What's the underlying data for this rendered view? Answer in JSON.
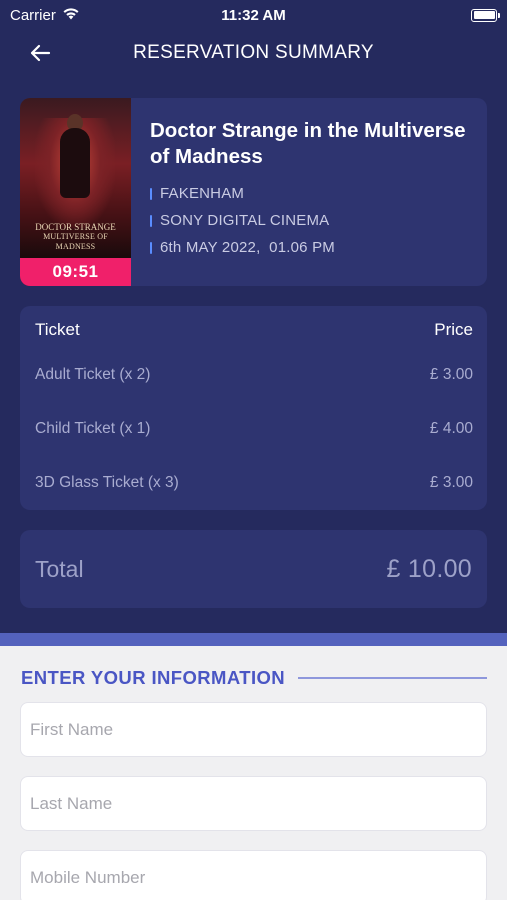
{
  "status_bar": {
    "carrier": "Carrier",
    "time": "11:32 AM",
    "icons": [
      "wifi-icon",
      "battery-icon"
    ]
  },
  "nav": {
    "back_icon": "arrow-left-icon",
    "title": "RESERVATION SUMMARY"
  },
  "movie": {
    "title": "Doctor Strange in the Multiverse of Madness",
    "poster_caption_line1": "DOCTOR STRANGE",
    "poster_caption_line2": "MULTIVERSE OF MADNESS",
    "countdown": "09:51",
    "location": "FAKENHAM",
    "cinema": "SONY DIGITAL CINEMA",
    "datetime": "6th MAY 2022,  01.06 PM"
  },
  "tickets": {
    "header_ticket": "Ticket",
    "header_price": "Price",
    "rows": [
      {
        "name": "Adult Ticket (x 2)",
        "price": "£ 3.00"
      },
      {
        "name": "Child Ticket (x 1)",
        "price": "£ 4.00"
      },
      {
        "name": "3D Glass Ticket (x 3)",
        "price": "£ 3.00"
      }
    ]
  },
  "total": {
    "label": "Total",
    "value": "£ 10.00"
  },
  "form": {
    "section_title": "ENTER YOUR INFORMATION",
    "first_name": {
      "value": "",
      "placeholder": "First Name"
    },
    "last_name": {
      "value": "",
      "placeholder": "Last Name"
    },
    "mobile": {
      "value": "",
      "placeholder": "Mobile Number"
    }
  },
  "colors": {
    "background": "#252a5e",
    "card": "#2e3470",
    "accent_pink": "#f0206a",
    "accent_blue": "#4a56c4",
    "meta_bar": "#5a8dff"
  }
}
